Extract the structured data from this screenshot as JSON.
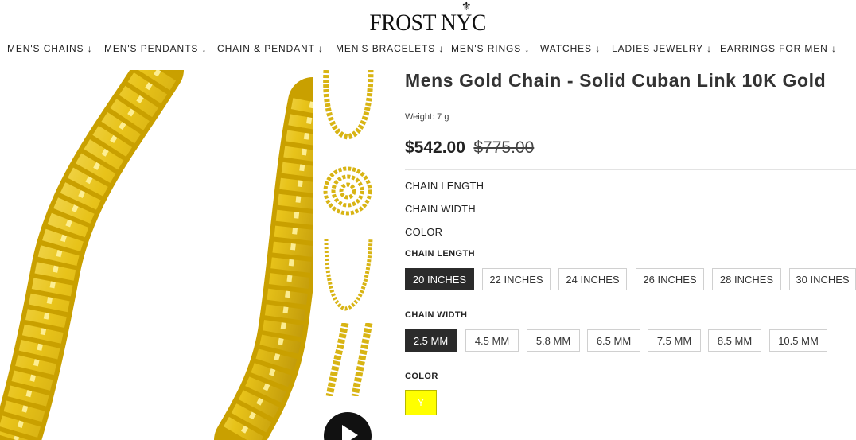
{
  "header": {
    "logo_text": "FROST NYC",
    "crest_icon": "fleur-de-lis-icon"
  },
  "nav": [
    {
      "label": "MEN'S CHAINS ↓"
    },
    {
      "label": "MEN'S PENDANTS ↓"
    },
    {
      "label": "CHAIN & PENDANT ↓"
    },
    {
      "label": "MEN'S BRACELETS ↓"
    },
    {
      "label": "MEN'S RINGS ↓"
    },
    {
      "label": "WATCHES ↓"
    },
    {
      "label": "LADIES JEWELRY ↓"
    },
    {
      "label": "EARRINGS FOR MEN ↓"
    }
  ],
  "product": {
    "title": "Mens Gold Chain - Solid Cuban Link 10K Gold",
    "weight": "Weight: 7 g",
    "price": "$542.00",
    "compare_price": "$775.00",
    "specs": [
      "CHAIN LENGTH",
      "CHAIN WIDTH",
      "COLOR"
    ],
    "chain_length": {
      "label": "CHAIN LENGTH",
      "selected": "20 INCHES",
      "options": [
        "20 INCHES",
        "22 INCHES",
        "24 INCHES",
        "26 INCHES",
        "28 INCHES",
        "30 INCHES"
      ]
    },
    "chain_width": {
      "label": "CHAIN WIDTH",
      "selected": "2.5 MM",
      "options": [
        "2.5 MM",
        "4.5 MM",
        "5.8 MM",
        "6.5 MM",
        "7.5 MM",
        "8.5 MM",
        "10.5 MM"
      ]
    },
    "color": {
      "label": "COLOR",
      "selected": "Y",
      "swatch_color": "#ffff00"
    }
  },
  "colors": {
    "gold": "#e8c31a",
    "selected_bg": "#2b2b2b"
  }
}
